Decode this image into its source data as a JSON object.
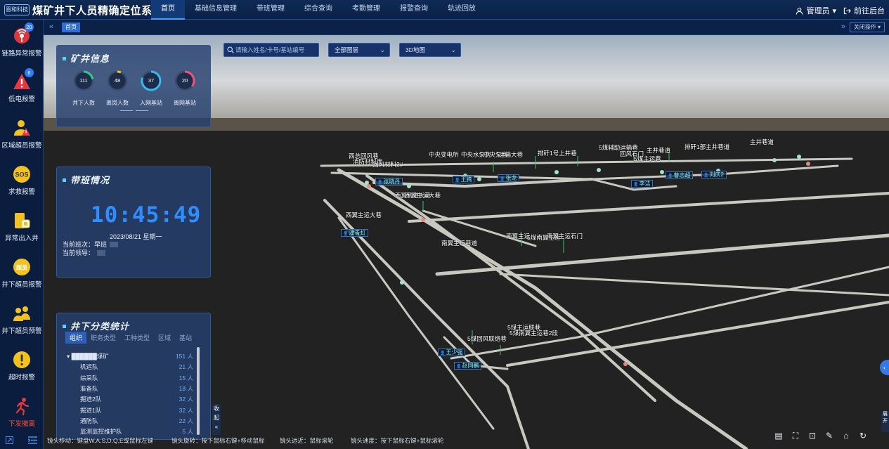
{
  "header": {
    "logo": "晋和科技",
    "title": "煤矿井下人员精确定位系统",
    "nav": [
      "首页",
      "基础信息管理",
      "带班管理",
      "综合查询",
      "考勤管理",
      "报警查询",
      "轨迹回放"
    ],
    "user": "管理员",
    "backend": "前往后台"
  },
  "sidebar": [
    {
      "label": "链路异常报警",
      "badge": "20",
      "icon": "signal-alarm-icon"
    },
    {
      "label": "低电报警",
      "badge": "6",
      "icon": "low-battery-icon"
    },
    {
      "label": "区域超员报警",
      "badge": "",
      "icon": "area-overload-icon"
    },
    {
      "label": "求救报警",
      "badge": "",
      "icon": "sos-icon"
    },
    {
      "label": "异常出入井",
      "badge": "",
      "icon": "abnormal-exit-icon"
    },
    {
      "label": "井下超员报警",
      "badge": "",
      "icon": "underground-overload-icon"
    },
    {
      "label": "井下超员预警",
      "badge": "",
      "icon": "overload-warning-icon"
    },
    {
      "label": "超时报警",
      "badge": "",
      "icon": "timeout-icon"
    },
    {
      "label": "下发撤离",
      "badge": "",
      "icon": "evacuate-icon"
    }
  ],
  "tabs": {
    "home": "首页",
    "close_ops": "关闭操作"
  },
  "mine_info": {
    "title": "矿井信息",
    "stats": [
      {
        "value": "111",
        "label": "井下人数",
        "color": "#2ecc8a",
        "fraction": 0.22
      },
      {
        "value": "48",
        "label": "离岗人数",
        "color": "#e8c52b",
        "fraction": 0.06
      },
      {
        "value": "37",
        "label": "入网基站",
        "color": "#35b9f0",
        "fraction": 0.8
      },
      {
        "value": "20",
        "label": "离网基站",
        "color": "#f0537a",
        "fraction": 0.35
      }
    ]
  },
  "shift": {
    "title": "带班情况",
    "clock": "10:45:49",
    "date": "2023/08/21 星期一",
    "current_shift_label": "当前班次：",
    "current_shift": "早班",
    "current_leader_label": "当前领导："
  },
  "stats": {
    "title": "井下分类统计",
    "tabs": [
      "组织",
      "职务类型",
      "工种类型",
      "区域",
      "基站"
    ],
    "rows": [
      {
        "name": "▾ ██████煤矿",
        "count": "151 人"
      },
      {
        "name": "机运队",
        "count": "21 人"
      },
      {
        "name": "综采队",
        "count": "15 人"
      },
      {
        "name": "准备队",
        "count": "18 人"
      },
      {
        "name": "掘进2队",
        "count": "32 人"
      },
      {
        "name": "掘进1队",
        "count": "32 人"
      },
      {
        "name": "通防队",
        "count": "22 人"
      },
      {
        "name": "监测监控维护队",
        "count": "5 人"
      }
    ],
    "collapse": "收起"
  },
  "search": {
    "placeholder": "请输入姓名/卡号/基站编号"
  },
  "selects": {
    "layer": "全部图层",
    "map": "3D地图"
  },
  "scene_labels": [
    "西总回风巷",
    "消防材料库",
    "回风材料2#",
    "中央变电所",
    "中央水泵房",
    "中央泵房",
    "运输大巷",
    "排矸1号上井巷",
    "5煤辅助运输巷",
    "回风石门",
    "5煤主运巷",
    "主井巷道",
    "排矸1部主井巷道",
    "主井巷道",
    "西翼主运大巷",
    "西翼轨道大巷",
    "西翼主运大巷",
    "南翼主运",
    "5煤南翼主运",
    "南翼主运石门",
    "南翼主运巷道",
    "5煤主运联巷",
    "5煤南翼主运巷2段",
    "5煤回风联络巷"
  ],
  "persons": [
    "张晓丹",
    "王腾",
    "张龙",
    "李洁",
    "曹志超",
    "刘庆2",
    "潘青虹",
    "王少强",
    "赵同鹏"
  ],
  "help": [
    "镜头移动：键盘W,A,S,D,Q,E或鼠标左键",
    "镜头旋转：按下鼠标右键+移动鼠标",
    "镜头远近：鼠标滚轮",
    "镜头速度：按下鼠标右键+鼠标滚轮"
  ]
}
